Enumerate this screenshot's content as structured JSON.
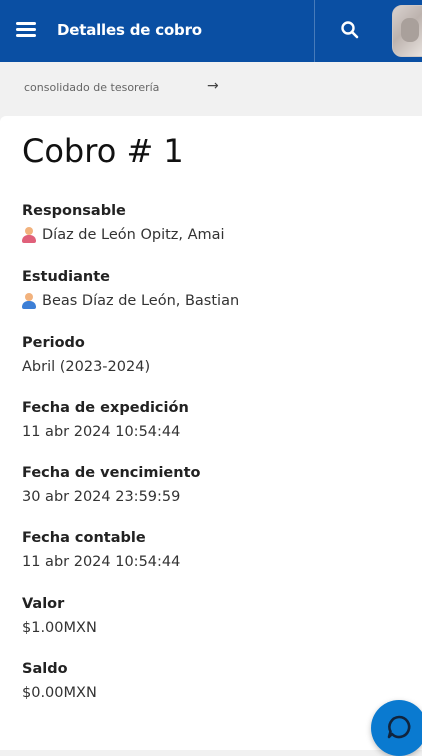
{
  "header": {
    "title": "Detalles de cobro",
    "menu_icon": "menu-icon",
    "search_icon": "search-icon",
    "brand_color": "#0a4fa3"
  },
  "breadcrumb": {
    "label": "consolidado de tesorería",
    "arrow": "→"
  },
  "page": {
    "title": "Cobro # 1"
  },
  "fields": [
    {
      "label": "Responsable",
      "value": "Díaz de León Opitz, Amai",
      "icon": "person-female-icon"
    },
    {
      "label": "Estudiante",
      "value": "Beas Díaz de León, Bastian",
      "icon": "person-male-icon"
    },
    {
      "label": "Periodo",
      "value": "Abril (2023-2024)"
    },
    {
      "label": "Fecha de expedición",
      "value": "11 abr 2024 10:54:44"
    },
    {
      "label": "Fecha de vencimiento",
      "value": "30 abr 2024 23:59:59"
    },
    {
      "label": "Fecha contable",
      "value": "11 abr 2024 10:54:44"
    },
    {
      "label": "Valor",
      "value": "$1.00MXN"
    },
    {
      "label": "Saldo",
      "value": "$0.00MXN"
    }
  ],
  "fab": {
    "icon": "chat-icon",
    "color": "#0a7ad0"
  }
}
